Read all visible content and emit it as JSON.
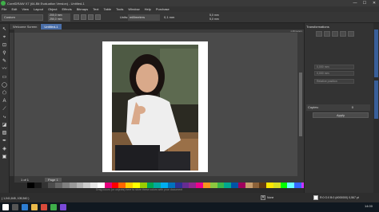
{
  "window": {
    "title": "CorelDRAW X7 (64-Bit Evaluation Version) - Untitled-1",
    "controls": [
      "—",
      "☐",
      "✕"
    ]
  },
  "menu": [
    "File",
    "Edit",
    "View",
    "Layout",
    "Object",
    "Effects",
    "Bitmaps",
    "Text",
    "Table",
    "Tools",
    "Window",
    "Help",
    "Purchase"
  ],
  "propbar": {
    "preset": "Custom",
    "width": "200,0 mm",
    "height": "250,0 mm",
    "units_label": "Units:",
    "units": "millimeters",
    "nudge": "0,1 mm",
    "dup_x": "5,0 mm",
    "dup_y": "5,0 mm"
  },
  "tabs": [
    "Welcome Screen",
    "Untitled-1"
  ],
  "ruler": {
    "unit": "millimeters"
  },
  "pagebar": {
    "page_label": "Page 1",
    "page_count": "1 of 1"
  },
  "palette_hint": "Drag colors (or objects) here to store these colors with your document",
  "status": {
    "coords": "( 1,041,845, 105,540 )",
    "fill_icon": "✕",
    "fill_name": "None",
    "fill_cmyk": "R:0 G:0 B:0 (#000000)  0,567 pt"
  },
  "docker": {
    "title": "Transformations",
    "fields": [
      "0,000 mm",
      "0,000 mm",
      "Relative position"
    ],
    "copies_label": "Copies:",
    "copies_value": "0",
    "apply_label": "Apply",
    "side_tabs": [
      "Transformations",
      "Object Properties"
    ]
  },
  "taskbar": {
    "time": "14:00"
  },
  "colors": {
    "accent": "#4a6ea8",
    "palette": [
      "#000000",
      "#1a1a1a",
      "#333333",
      "#4d4d4d",
      "#666666",
      "#808080",
      "#999999",
      "#b3b3b3",
      "#cccccc",
      "#e6e6e6",
      "#ffffff",
      "#e6007e",
      "#ff0000",
      "#ff6600",
      "#ffcc00",
      "#ffff00",
      "#99cc00",
      "#00a651",
      "#00a99d",
      "#00aeef",
      "#0072bc",
      "#2e3192",
      "#662d91",
      "#92278f",
      "#ec008c",
      "#f7941d",
      "#8dc63f",
      "#39b54a",
      "#00a88f",
      "#0054a6",
      "#9e005d",
      "#c69c6d",
      "#8c6239",
      "#603913",
      "#ffe600",
      "#d7df23",
      "#00ff00",
      "#66ffff",
      "#3366ff",
      "#cc33ff",
      "#ff99cc",
      "#ffcc99",
      "#ccff99",
      "#99ffcc",
      "#99ccff",
      "#cc99ff",
      "#ff6666",
      "#66cc66",
      "#6699cc",
      "#cc6699"
    ]
  }
}
